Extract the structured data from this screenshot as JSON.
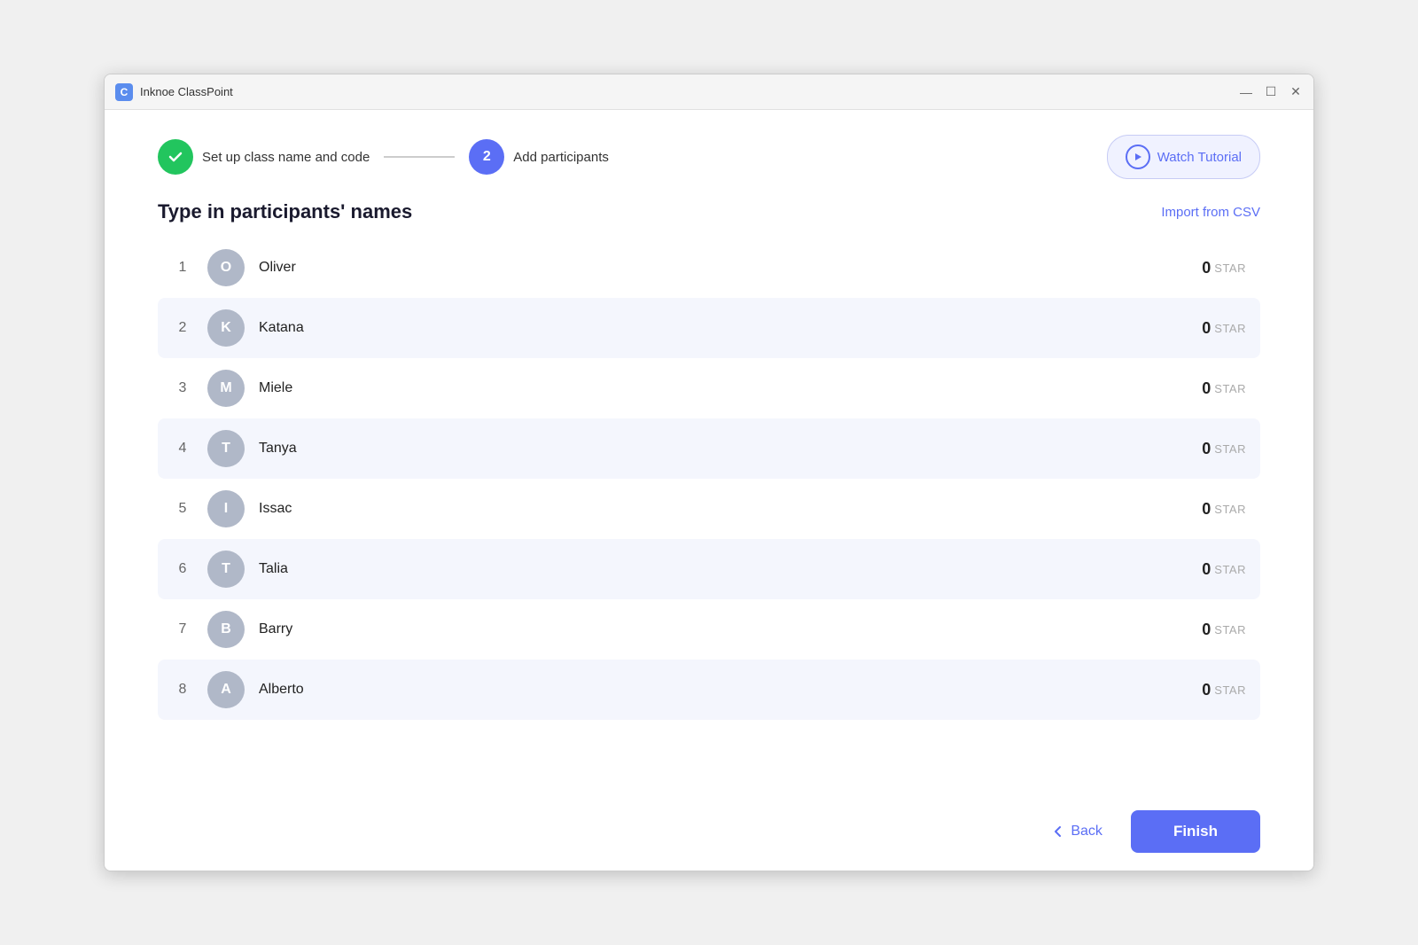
{
  "app": {
    "title": "Inknoe ClassPoint",
    "icon_label": "C"
  },
  "title_bar": {
    "minimize_label": "—",
    "maximize_label": "☐",
    "close_label": "✕"
  },
  "stepper": {
    "step1": {
      "label": "Set up class name and code",
      "state": "done"
    },
    "step2": {
      "number": "2",
      "label": "Add participants",
      "state": "active"
    },
    "watch_tutorial_label": "Watch Tutorial"
  },
  "section": {
    "title": "Type in participants' names",
    "import_csv_label": "Import from CSV"
  },
  "participants": [
    {
      "number": 1,
      "initial": "O",
      "name": "Oliver",
      "stars": 0,
      "star_label": "STAR",
      "alt": false
    },
    {
      "number": 2,
      "initial": "K",
      "name": "Katana",
      "stars": 0,
      "star_label": "STAR",
      "alt": true
    },
    {
      "number": 3,
      "initial": "M",
      "name": "Miele",
      "stars": 0,
      "star_label": "STAR",
      "alt": false
    },
    {
      "number": 4,
      "initial": "T",
      "name": "Tanya",
      "stars": 0,
      "star_label": "STAR",
      "alt": true
    },
    {
      "number": 5,
      "initial": "I",
      "name": "Issac",
      "stars": 0,
      "star_label": "STAR",
      "alt": false
    },
    {
      "number": 6,
      "initial": "T",
      "name": "Talia",
      "stars": 0,
      "star_label": "STAR",
      "alt": true
    },
    {
      "number": 7,
      "initial": "B",
      "name": "Barry",
      "stars": 0,
      "star_label": "STAR",
      "alt": false
    },
    {
      "number": 8,
      "initial": "A",
      "name": "Alberto",
      "stars": 0,
      "star_label": "STAR",
      "alt": true
    }
  ],
  "footer": {
    "back_label": "Back",
    "finish_label": "Finish"
  }
}
